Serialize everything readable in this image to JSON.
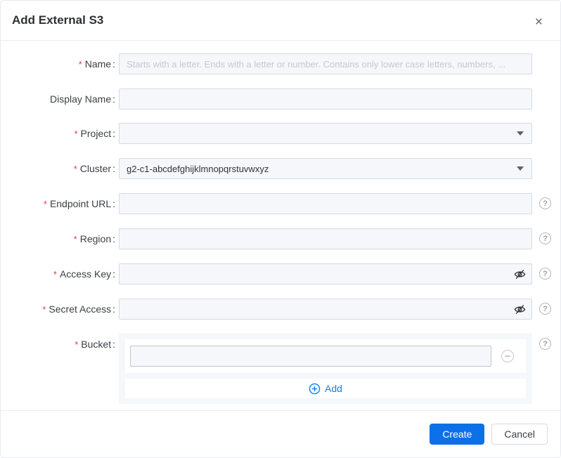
{
  "dialog": {
    "title": "Add External S3",
    "close_glyph": "×"
  },
  "shared": {
    "required_marker": "*",
    "label_colon": ":",
    "help_glyph": "?"
  },
  "fields": {
    "name": {
      "label": "Name",
      "required": true,
      "placeholder": "Starts with a letter. Ends with a letter or number. Contains only lower case letters, numbers, ...",
      "value": ""
    },
    "display_name": {
      "label": "Display Name",
      "required": false,
      "value": ""
    },
    "project": {
      "label": "Project",
      "required": true,
      "value": ""
    },
    "cluster": {
      "label": "Cluster",
      "required": true,
      "value": "g2-c1-abcdefghijklmnopqrstuvwxyz"
    },
    "endpoint_url": {
      "label": "Endpoint URL",
      "required": true,
      "value": ""
    },
    "region": {
      "label": "Region",
      "required": true,
      "value": ""
    },
    "access_key": {
      "label": "Access Key",
      "required": true,
      "value": ""
    },
    "secret_access": {
      "label": "Secret Access",
      "required": true,
      "value": ""
    },
    "bucket": {
      "label": "Bucket",
      "required": true,
      "items": [
        {
          "value": ""
        }
      ],
      "add_label": "Add"
    }
  },
  "footer": {
    "create_label": "Create",
    "cancel_label": "Cancel"
  },
  "colors": {
    "accent_blue": "#0c70e9",
    "link_blue": "#1080e8",
    "required_red": "#e6394a",
    "input_bg": "#f5f7fa",
    "panel_bg": "#f5f7fa"
  }
}
